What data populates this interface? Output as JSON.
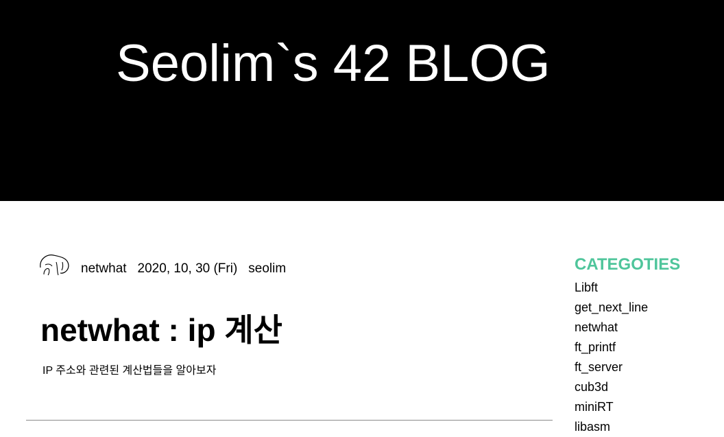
{
  "header": {
    "blog_title": "Seolim`s 42 BLOG",
    "background": "#000000",
    "title_color": "#ffffff"
  },
  "post": {
    "category": "netwhat",
    "date": "2020, 10, 30 (Fri)",
    "author": "seolim",
    "title": "netwhat : ip 계산",
    "excerpt": "IP 주소와 관련된 계산법들을 알아보자",
    "avatar_icon": "handdrawn-avatar-icon"
  },
  "sidebar": {
    "heading": "CATEGOTIES",
    "heading_color": "#4fc59b",
    "categories": [
      "Libft",
      "get_next_line",
      "netwhat",
      "ft_printf",
      "ft_server",
      "cub3d",
      "miniRT",
      "libasm"
    ]
  }
}
